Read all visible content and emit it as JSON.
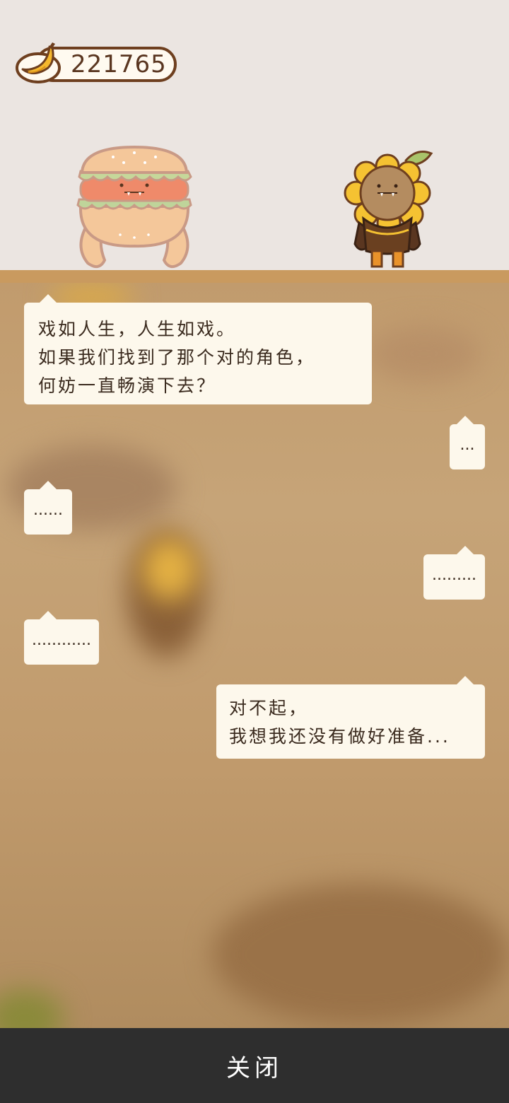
{
  "hud": {
    "banana_count": "221765",
    "currency_icon": "banana-icon"
  },
  "characters": [
    {
      "name": "burger-character",
      "icon": "burger-character"
    },
    {
      "name": "sunflower-character",
      "icon": "sunflower-character"
    }
  ],
  "dialogue": [
    {
      "side": "left",
      "text": "戏如人生，人生如戏。\n如果我们找到了那个对的角色，\n何妨一直畅演下去？"
    },
    {
      "side": "right",
      "text": "..."
    },
    {
      "side": "left",
      "text": "......"
    },
    {
      "side": "right",
      "text": "........."
    },
    {
      "side": "left",
      "text": "............"
    },
    {
      "side": "right",
      "text": "对不起，\n我想我还没有做好准备..."
    }
  ],
  "footer": {
    "close_label": "关闭"
  },
  "colors": {
    "stage_bg": "#ebe5e1",
    "shelf": "#c99a5f",
    "bubble_bg": "#fdf8ec",
    "bottom_bar": "#2e2e2e",
    "coin_border": "#6e3f1f"
  }
}
